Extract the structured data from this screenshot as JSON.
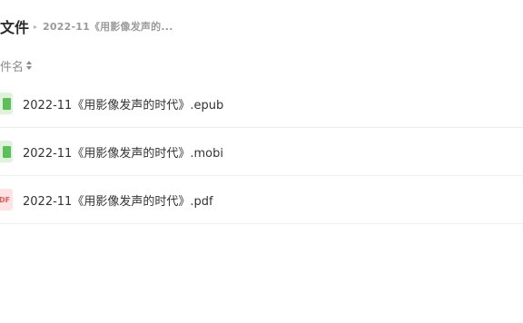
{
  "header": {
    "title": "文件",
    "breadcrumb_sep": "▸",
    "breadcrumb": "2022-11《用影像发声的..."
  },
  "column": {
    "name_label": "件名"
  },
  "files": [
    {
      "name": "2022-11《用影像发声的时代》.epub",
      "icon": "book-icon"
    },
    {
      "name": "2022-11《用影像发声的时代》.mobi",
      "icon": "book-icon"
    },
    {
      "name": "2022-11《用影像发声的时代》.pdf",
      "icon": "pdf-icon",
      "icon_text": "DF"
    }
  ]
}
